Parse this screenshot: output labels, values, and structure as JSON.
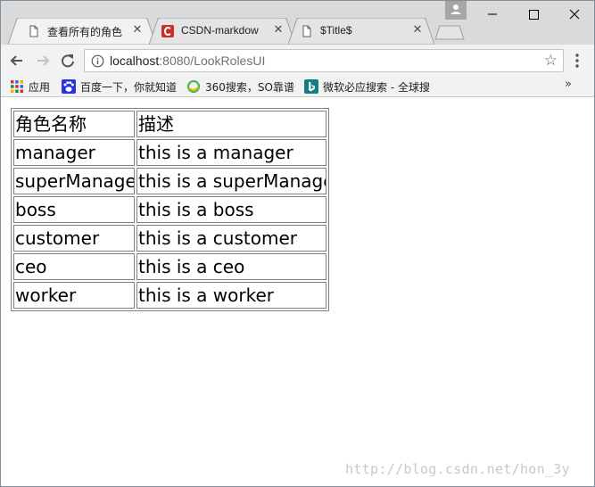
{
  "browser": {
    "tabs": [
      {
        "title": "查看所有的角色",
        "icon": "document-icon",
        "active": true
      },
      {
        "title": "CSDN-markdow",
        "icon": "csdn-logo-icon",
        "active": false
      },
      {
        "title": "$Title$",
        "icon": "document-icon",
        "active": false
      }
    ],
    "address": {
      "host": "localhost",
      "path": ":8080/LookRolesUI"
    },
    "bookmarks": [
      {
        "label": "应用",
        "icon": "apps-grid-icon"
      },
      {
        "label": "百度一下，你就知道",
        "icon": "baidu-paw-icon"
      },
      {
        "label": "360搜索，SO靠谱",
        "icon": "360-search-icon"
      },
      {
        "label": "微软必应搜索 - 全球搜",
        "icon": "bing-icon"
      }
    ]
  },
  "page": {
    "table": {
      "headers": [
        "角色名称",
        "描述"
      ],
      "rows": [
        [
          "manager",
          "this is a manager"
        ],
        [
          "superManage",
          "this is a superManage"
        ],
        [
          "boss",
          "this is a boss"
        ],
        [
          "customer",
          "this is a customer"
        ],
        [
          "ceo",
          "this is a ceo"
        ],
        [
          "worker",
          "this is a worker"
        ]
      ]
    }
  },
  "watermark": "http://blog.csdn.net/hon_3y"
}
